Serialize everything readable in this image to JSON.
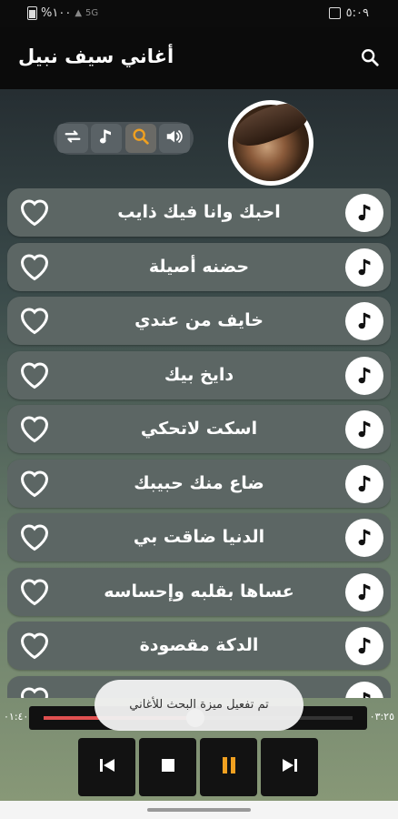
{
  "status": {
    "time": "٥:٠٩",
    "battery": "%١٠٠",
    "network": "5G"
  },
  "app": {
    "title": "أغاني سيف نبيل"
  },
  "toolbar": {
    "buttons": [
      "repeat-icon",
      "music-note-icon",
      "search-icon",
      "volume-icon"
    ],
    "active_color": "#f0a020"
  },
  "songs": [
    "احبك وانا فيك ذايب",
    "حضنه أصيلة",
    "خايف من عندي",
    "دايخ بيك",
    "اسكت لاتحكي",
    "ضاع منك حبيبك",
    "الدنيا ضاقت بي",
    "عساها بقلبه وإحساسه",
    "الدكة مقصودة",
    ""
  ],
  "player": {
    "elapsed": "٠١:٤٠",
    "total": "٠٣:٢٥",
    "progress": 0.49
  },
  "toast": {
    "message": "تم تفعيل ميزة البحث للأغاني"
  },
  "colors": {
    "pause": "#f0a020",
    "progress": "#e05050"
  }
}
